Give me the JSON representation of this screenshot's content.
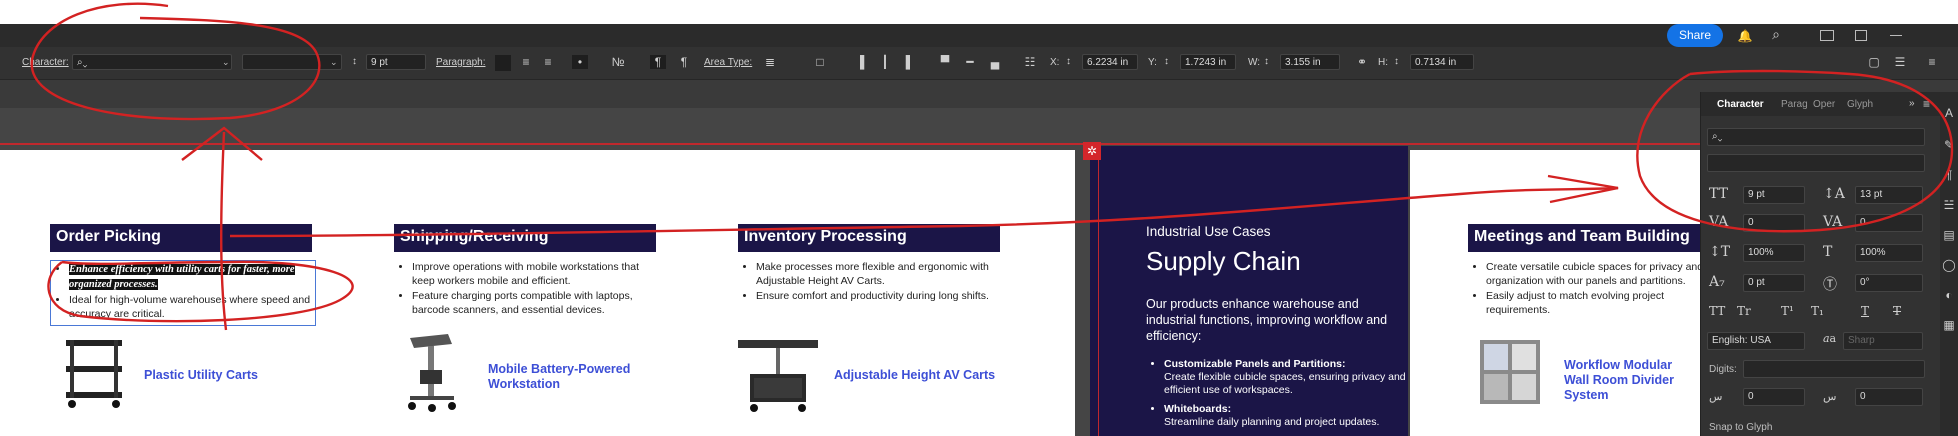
{
  "appbar": {
    "share_label": "Share"
  },
  "control_bar": {
    "character_label": "Character:",
    "font_size": "9 pt",
    "paragraph_label": "Paragraph:",
    "area_type_label": "Area Type:",
    "x_label": "X:",
    "x_value": "6.2234 in",
    "y_label": "Y:",
    "y_value": "1.7243 in",
    "w_label": "W:",
    "w_value": "3.155 in",
    "h_label": "H:",
    "h_value": "0.7134 in"
  },
  "document": {
    "sections": [
      {
        "title": "Order Picking",
        "bullets": [
          "Enhance efficiency with utility carts for faster, more organized processes.",
          "Ideal for high-volume warehouses where speed and accuracy are critical."
        ],
        "product": "Plastic Utility Carts"
      },
      {
        "title": "Shipping/Receiving",
        "bullets": [
          "Improve operations with mobile workstations that keep workers mobile and efficient.",
          "Feature charging ports compatible with laptops, barcode scanners, and essential devices."
        ],
        "product": "Mobile Battery-Powered Workstation"
      },
      {
        "title": "Inventory Processing",
        "bullets": [
          "Make processes more flexible and ergonomic with Adjustable Height AV Carts.",
          "Ensure comfort and productivity during long shifts."
        ],
        "product": "Adjustable Height AV Carts"
      }
    ],
    "feature": {
      "kicker": "Industrial Use Cases",
      "title": "Supply Chain",
      "intro": "Our products enhance warehouse and industrial functions, improving workflow and efficiency:",
      "items": [
        {
          "label": "Customizable Panels and Partitions:",
          "text": "Create flexible cubicle spaces, ensuring privacy and efficient use of workspaces."
        },
        {
          "label": "Whiteboards:",
          "text": "Streamline daily planning and project updates."
        }
      ]
    },
    "meetings": {
      "title": "Meetings and Team Building",
      "bullets": [
        "Create versatile cubicle spaces for privacy and organization with our panels and partitions.",
        "Easily adjust to match evolving project requirements."
      ],
      "product": "Workflow Modular Wall Room Divider System"
    }
  },
  "panel": {
    "tabs": [
      "Character",
      "Parag",
      "Oper",
      "Glyph"
    ],
    "font_size": "9 pt",
    "leading": "13 pt",
    "kerning": "0",
    "tracking": "0",
    "vscale": "100%",
    "hscale": "100%",
    "baseline": "0 pt",
    "rotation": "0°",
    "language": "English: USA",
    "aa": "Sharp",
    "digits_label": "Digits:",
    "indent_left": "0",
    "indent_right": "0",
    "snap_label": "Snap to Glyph"
  },
  "colors": {
    "header_navy": "#1b1547",
    "link_blue": "#3d4fd6",
    "annotation_red": "#d32222",
    "share_blue": "#1473e6"
  }
}
